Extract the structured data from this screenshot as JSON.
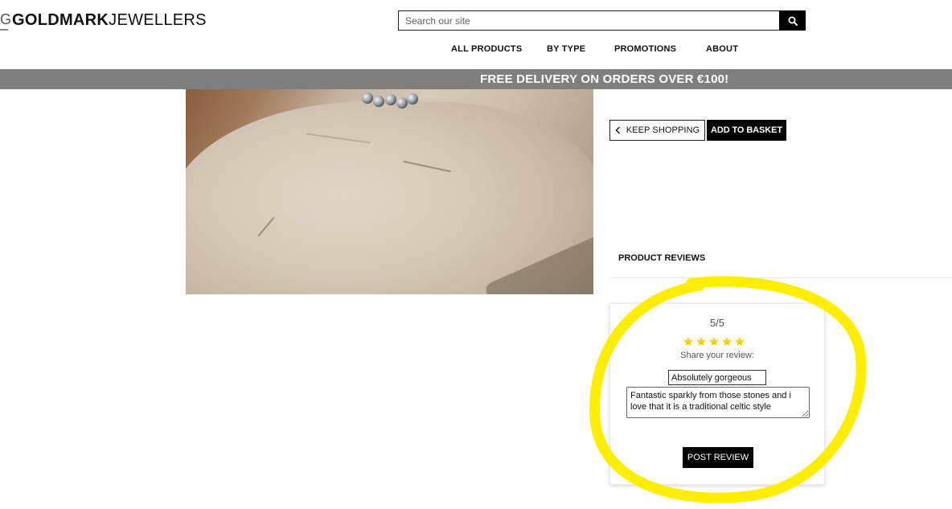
{
  "header": {
    "logo_bold": "GOLDMARK",
    "logo_thin": "JEWELLERS",
    "search_placeholder": "Search our site"
  },
  "nav": {
    "items": [
      "ALL PRODUCTS",
      "BY TYPE",
      "PROMOTIONS",
      "ABOUT"
    ]
  },
  "banner": {
    "text": "FREE DELIVERY ON ORDERS OVER €100!"
  },
  "actions": {
    "keep_shopping": "KEEP SHOPPING",
    "add_to_basket": "ADD TO BASKET"
  },
  "reviews": {
    "section_title": "PRODUCT REVIEWS",
    "score": "5/5",
    "rating": 5,
    "rating_max": 5,
    "share_label": "Share your review:",
    "title_value": "Absolutely gorgeous",
    "body_value": "Fantastic sparkly from those stones and i love that it is a traditional celtic style",
    "post_label": "POST REVIEW"
  },
  "colors": {
    "banner_bg": "#7f7f7f",
    "star": "#f3d20a",
    "highlight": "#ffee00"
  },
  "icons": {
    "search": "search-icon",
    "keep_shopping": "chevron-left-icon",
    "rating": "star-icon"
  }
}
